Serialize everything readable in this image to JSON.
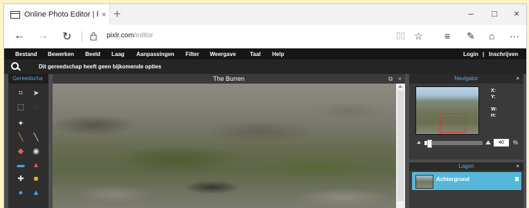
{
  "browser": {
    "tab_title": "Online Photo Editor | Pi:",
    "tab_close": "×",
    "new_tab": "+",
    "win_minimize": "–",
    "win_maximize": "□",
    "win_close": "×",
    "nav_back": "←",
    "nav_forward": "→",
    "nav_refresh": "↻",
    "url_host": "pixlr.com",
    "url_path": "/editor",
    "favorite_star": "☆",
    "hub_icon": "≡",
    "note_icon": "✎",
    "share_icon": "⌂",
    "more_icon": "···"
  },
  "menu": {
    "items": [
      "Bestand",
      "Bewerken",
      "Beeld",
      "Laag",
      "Aanpassingen",
      "Filter",
      "Weergave",
      "Taal",
      "Help"
    ],
    "login": "Login",
    "separator": "|",
    "register": "Inschrijven"
  },
  "options_bar": {
    "message": "Dit gereedschap heeft geen bijkomende opties"
  },
  "tools_panel": {
    "title": "Gereedscha",
    "tools": [
      {
        "glyph": "⌗",
        "color": "#d8d8d8",
        "name": "crop-tool-icon"
      },
      {
        "glyph": "➤",
        "color": "#d8d8d8",
        "name": "move-tool-icon"
      },
      {
        "glyph": "⬚",
        "color": "#d8d8d8",
        "name": "marquee-tool-icon"
      },
      {
        "glyph": "◌",
        "color": "#e04040",
        "name": "lasso-tool-icon"
      },
      {
        "glyph": "✦",
        "color": "#e0e0e0",
        "name": "wand-tool-icon"
      },
      {
        "glyph": "",
        "color": "#d8d8d8",
        "name": "empty-tool-slot"
      },
      {
        "glyph": "╲",
        "color": "#f0a020",
        "name": "pencil-tool-icon"
      },
      {
        "glyph": "╲",
        "color": "#d8d8d8",
        "name": "brush-tool-icon"
      },
      {
        "glyph": "◆",
        "color": "#e86060",
        "name": "eraser-tool-icon"
      },
      {
        "glyph": "◉",
        "color": "#e0e0e0",
        "name": "bucket-tool-icon"
      },
      {
        "glyph": "▬",
        "color": "#4ea0e0",
        "name": "gradient-tool-icon"
      },
      {
        "glyph": "▲",
        "color": "#e05050",
        "name": "stamp-tool-icon"
      },
      {
        "glyph": "✚",
        "color": "#e0e0e0",
        "name": "drawing-tool-icon"
      },
      {
        "glyph": "■",
        "color": "#f0b030",
        "name": "shape-tool-icon"
      },
      {
        "glyph": "●",
        "color": "#4ea0e0",
        "name": "drop-tool-icon"
      },
      {
        "glyph": "▲",
        "color": "#4ea0e0",
        "name": "sharpen-tool-icon"
      }
    ]
  },
  "document": {
    "title": "The Burren",
    "popout_icon": "⧉",
    "close_icon": "×"
  },
  "navigator": {
    "title": "Navigator",
    "close": "×",
    "x_label": "X:",
    "y_label": "Y:",
    "w_label": "W:",
    "h_label": "H:",
    "zoom_value": "40",
    "zoom_unit": "%",
    "zoom_fraction": 0.05
  },
  "layers": {
    "title": "Lagen",
    "close": "×",
    "items": [
      {
        "name": "Achtergrond"
      }
    ]
  }
}
